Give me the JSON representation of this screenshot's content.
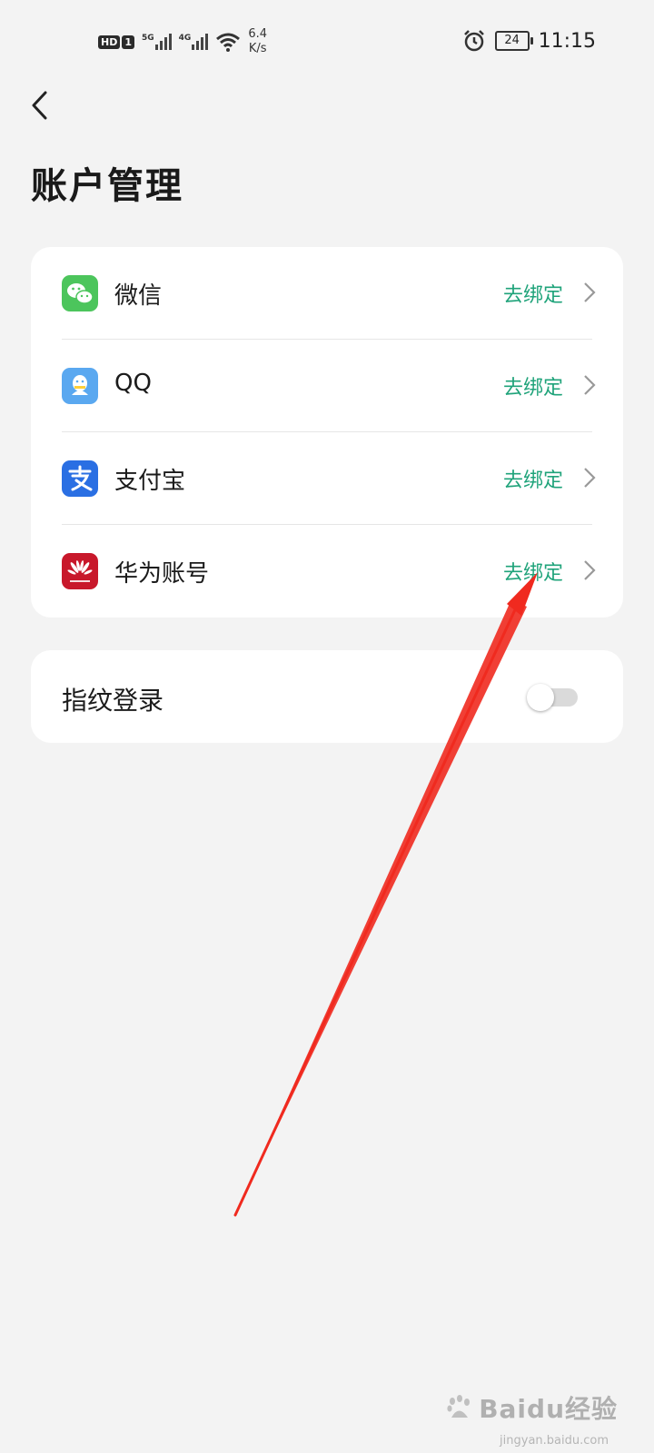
{
  "status_bar": {
    "hd_label": "HD",
    "sim_label": "1",
    "network_1": "5G",
    "network_2": "4G",
    "speed_value": "6.4",
    "speed_unit": "K/s",
    "battery_level": "24",
    "time": "11:15"
  },
  "page": {
    "title": "账户管理"
  },
  "accounts": [
    {
      "label": "微信",
      "action": "去绑定",
      "icon": "wechat-icon",
      "color": "#4cc55c"
    },
    {
      "label": "QQ",
      "action": "去绑定",
      "icon": "qq-icon",
      "color": "#5aa8f0"
    },
    {
      "label": "支付宝",
      "action": "去绑定",
      "icon": "alipay-icon",
      "color": "#2a6fe3"
    },
    {
      "label": "华为账号",
      "action": "去绑定",
      "icon": "huawei-icon",
      "color": "#c8182b"
    }
  ],
  "fingerprint": {
    "label": "指纹登录",
    "enabled": false
  },
  "colors": {
    "accent_green": "#1fa37a",
    "annotation_red": "#f02a1f",
    "background": "#f3f3f3"
  },
  "watermark": {
    "brand": "Baidu经验",
    "sub": "jingyan.baidu.com"
  }
}
